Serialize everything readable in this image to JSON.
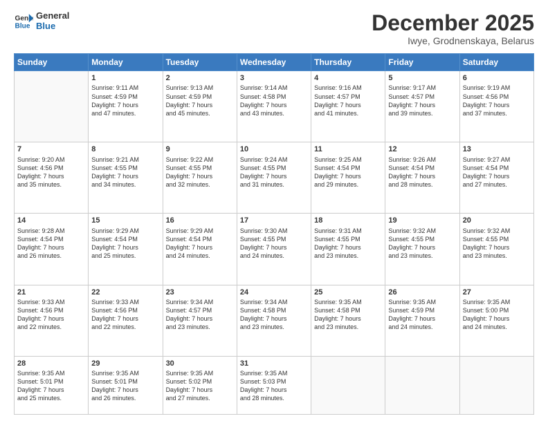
{
  "logo": {
    "line1": "General",
    "line2": "Blue"
  },
  "header": {
    "month": "December 2025",
    "location": "Iwye, Grodnenskaya, Belarus"
  },
  "weekdays": [
    "Sunday",
    "Monday",
    "Tuesday",
    "Wednesday",
    "Thursday",
    "Friday",
    "Saturday"
  ],
  "weeks": [
    [
      {
        "day": "",
        "info": ""
      },
      {
        "day": "1",
        "info": "Sunrise: 9:11 AM\nSunset: 4:59 PM\nDaylight: 7 hours\nand 47 minutes."
      },
      {
        "day": "2",
        "info": "Sunrise: 9:13 AM\nSunset: 4:59 PM\nDaylight: 7 hours\nand 45 minutes."
      },
      {
        "day": "3",
        "info": "Sunrise: 9:14 AM\nSunset: 4:58 PM\nDaylight: 7 hours\nand 43 minutes."
      },
      {
        "day": "4",
        "info": "Sunrise: 9:16 AM\nSunset: 4:57 PM\nDaylight: 7 hours\nand 41 minutes."
      },
      {
        "day": "5",
        "info": "Sunrise: 9:17 AM\nSunset: 4:57 PM\nDaylight: 7 hours\nand 39 minutes."
      },
      {
        "day": "6",
        "info": "Sunrise: 9:19 AM\nSunset: 4:56 PM\nDaylight: 7 hours\nand 37 minutes."
      }
    ],
    [
      {
        "day": "7",
        "info": "Sunrise: 9:20 AM\nSunset: 4:56 PM\nDaylight: 7 hours\nand 35 minutes."
      },
      {
        "day": "8",
        "info": "Sunrise: 9:21 AM\nSunset: 4:55 PM\nDaylight: 7 hours\nand 34 minutes."
      },
      {
        "day": "9",
        "info": "Sunrise: 9:22 AM\nSunset: 4:55 PM\nDaylight: 7 hours\nand 32 minutes."
      },
      {
        "day": "10",
        "info": "Sunrise: 9:24 AM\nSunset: 4:55 PM\nDaylight: 7 hours\nand 31 minutes."
      },
      {
        "day": "11",
        "info": "Sunrise: 9:25 AM\nSunset: 4:54 PM\nDaylight: 7 hours\nand 29 minutes."
      },
      {
        "day": "12",
        "info": "Sunrise: 9:26 AM\nSunset: 4:54 PM\nDaylight: 7 hours\nand 28 minutes."
      },
      {
        "day": "13",
        "info": "Sunrise: 9:27 AM\nSunset: 4:54 PM\nDaylight: 7 hours\nand 27 minutes."
      }
    ],
    [
      {
        "day": "14",
        "info": "Sunrise: 9:28 AM\nSunset: 4:54 PM\nDaylight: 7 hours\nand 26 minutes."
      },
      {
        "day": "15",
        "info": "Sunrise: 9:29 AM\nSunset: 4:54 PM\nDaylight: 7 hours\nand 25 minutes."
      },
      {
        "day": "16",
        "info": "Sunrise: 9:29 AM\nSunset: 4:54 PM\nDaylight: 7 hours\nand 24 minutes."
      },
      {
        "day": "17",
        "info": "Sunrise: 9:30 AM\nSunset: 4:55 PM\nDaylight: 7 hours\nand 24 minutes."
      },
      {
        "day": "18",
        "info": "Sunrise: 9:31 AM\nSunset: 4:55 PM\nDaylight: 7 hours\nand 23 minutes."
      },
      {
        "day": "19",
        "info": "Sunrise: 9:32 AM\nSunset: 4:55 PM\nDaylight: 7 hours\nand 23 minutes."
      },
      {
        "day": "20",
        "info": "Sunrise: 9:32 AM\nSunset: 4:55 PM\nDaylight: 7 hours\nand 23 minutes."
      }
    ],
    [
      {
        "day": "21",
        "info": "Sunrise: 9:33 AM\nSunset: 4:56 PM\nDaylight: 7 hours\nand 22 minutes."
      },
      {
        "day": "22",
        "info": "Sunrise: 9:33 AM\nSunset: 4:56 PM\nDaylight: 7 hours\nand 22 minutes."
      },
      {
        "day": "23",
        "info": "Sunrise: 9:34 AM\nSunset: 4:57 PM\nDaylight: 7 hours\nand 23 minutes."
      },
      {
        "day": "24",
        "info": "Sunrise: 9:34 AM\nSunset: 4:58 PM\nDaylight: 7 hours\nand 23 minutes."
      },
      {
        "day": "25",
        "info": "Sunrise: 9:35 AM\nSunset: 4:58 PM\nDaylight: 7 hours\nand 23 minutes."
      },
      {
        "day": "26",
        "info": "Sunrise: 9:35 AM\nSunset: 4:59 PM\nDaylight: 7 hours\nand 24 minutes."
      },
      {
        "day": "27",
        "info": "Sunrise: 9:35 AM\nSunset: 5:00 PM\nDaylight: 7 hours\nand 24 minutes."
      }
    ],
    [
      {
        "day": "28",
        "info": "Sunrise: 9:35 AM\nSunset: 5:01 PM\nDaylight: 7 hours\nand 25 minutes."
      },
      {
        "day": "29",
        "info": "Sunrise: 9:35 AM\nSunset: 5:01 PM\nDaylight: 7 hours\nand 26 minutes."
      },
      {
        "day": "30",
        "info": "Sunrise: 9:35 AM\nSunset: 5:02 PM\nDaylight: 7 hours\nand 27 minutes."
      },
      {
        "day": "31",
        "info": "Sunrise: 9:35 AM\nSunset: 5:03 PM\nDaylight: 7 hours\nand 28 minutes."
      },
      {
        "day": "",
        "info": ""
      },
      {
        "day": "",
        "info": ""
      },
      {
        "day": "",
        "info": ""
      }
    ]
  ]
}
